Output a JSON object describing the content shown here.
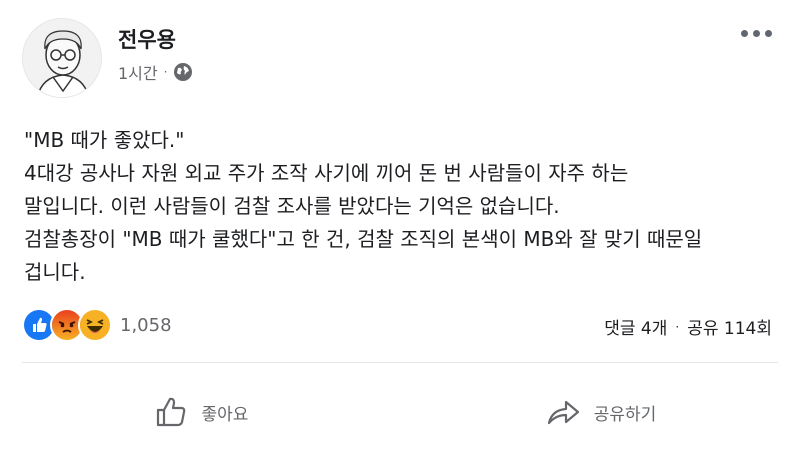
{
  "post": {
    "author": "전우용",
    "time": "1시간",
    "separator": "·",
    "privacy_icon": "globe-icon",
    "more_icon": "more-options-icon",
    "lines": [
      "\"MB 때가 좋았다.\"",
      "4대강 공사나 자원 외교 주가 조작 사기에 끼어 돈 번 사람들이 자주 하는",
      "말입니다. 이런 사람들이 검찰 조사를 받았다는 기억은 없습니다.",
      "검찰총장이 \"MB 때가 쿨했다\"고 한 건, 검찰 조직의 본색이 MB와 잘 맞기 때문일",
      "겁니다."
    ]
  },
  "reactions": {
    "icons": [
      "like-icon",
      "angry-icon",
      "haha-icon"
    ],
    "count": "1,058"
  },
  "stats": {
    "comments": "댓글 4개",
    "separator": "·",
    "shares": "공유 114회"
  },
  "actions": {
    "like": "좋아요",
    "share": "공유하기"
  },
  "colors": {
    "text": "#1c1e21",
    "secondary": "#65676b",
    "like_blue": "#1877f2",
    "angry_red": "#e9710f",
    "haha_yellow": "#f7b125"
  }
}
